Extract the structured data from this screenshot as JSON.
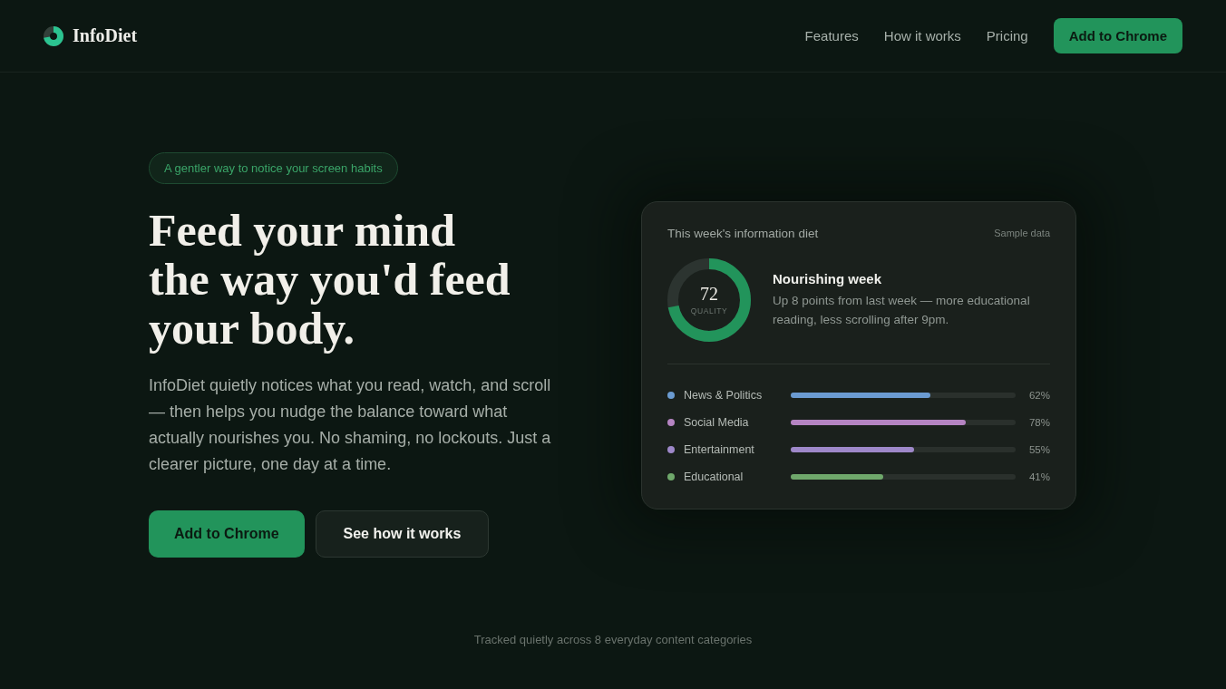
{
  "header": {
    "logo": "InfoDiet",
    "nav": [
      "Features",
      "How it works",
      "Pricing"
    ],
    "cta": "Add to Chrome"
  },
  "hero": {
    "badge": "A gentler way to notice your screen habits",
    "heading": "Feed your mind\nthe way you'd feed\nyour body.",
    "text": "InfoDiet quietly notices what you read, watch, and scroll — then helps you nudge the balance toward what actually nourishes you. No shaming, no lockouts. Just a clearer picture, one day at a time.",
    "buttons": [
      {
        "label": "Add to Chrome",
        "kind": "primary"
      },
      {
        "label": "See how it works",
        "kind": "secondary"
      }
    ]
  },
  "card": {
    "title": "This week's information diet",
    "note": "Sample data",
    "score": {
      "value": "72",
      "label": "QUALITY",
      "level": 0.72
    },
    "summary_title": "Nourishing week",
    "summary": "Up 8 points from last week — more educational reading, less scrolling after 9pm.",
    "categories": [
      {
        "name": "News & Politics",
        "color": "#6b9bd1",
        "level": 0.62,
        "reading": "62%"
      },
      {
        "name": "Social Media",
        "color": "#b584c2",
        "level": 0.78,
        "reading": "78%"
      },
      {
        "name": "Entertainment",
        "color": "#9e88c9",
        "level": 0.55,
        "reading": "55%"
      },
      {
        "name": "Educational",
        "color": "#6fa86b",
        "level": 0.41,
        "reading": "41%"
      }
    ]
  },
  "footer_note": "Tracked quietly across 8 everyday content categories"
}
